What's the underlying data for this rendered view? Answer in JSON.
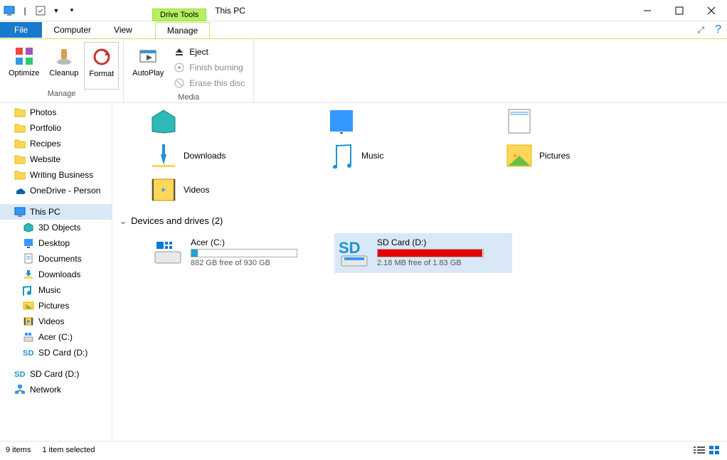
{
  "title": "This PC",
  "titlebar": {
    "drive_tools": "Drive Tools"
  },
  "tabs": {
    "file": "File",
    "computer": "Computer",
    "view": "View",
    "manage": "Manage"
  },
  "ribbon": {
    "manage_group": {
      "label": "Manage",
      "optimize": "Optimize",
      "cleanup": "Cleanup",
      "format": "Format"
    },
    "media_group": {
      "label": "Media",
      "autoplay": "AutoPlay",
      "eject": "Eject",
      "finish_burning": "Finish burning",
      "erase_disc": "Erase this disc"
    }
  },
  "sidebar": {
    "items": [
      {
        "label": "Photos",
        "icon": "folder"
      },
      {
        "label": "Portfolio",
        "icon": "folder"
      },
      {
        "label": "Recipes",
        "icon": "folder"
      },
      {
        "label": "Website",
        "icon": "folder"
      },
      {
        "label": "Writing Business",
        "icon": "folder"
      },
      {
        "label": "OneDrive - Person",
        "icon": "onedrive"
      },
      {
        "label": "This PC",
        "icon": "pc",
        "selected": true
      },
      {
        "label": "3D Objects",
        "icon": "3d",
        "level": 2
      },
      {
        "label": "Desktop",
        "icon": "desktop",
        "level": 2
      },
      {
        "label": "Documents",
        "icon": "documents",
        "level": 2
      },
      {
        "label": "Downloads",
        "icon": "downloads",
        "level": 2
      },
      {
        "label": "Music",
        "icon": "music",
        "level": 2
      },
      {
        "label": "Pictures",
        "icon": "pictures",
        "level": 2
      },
      {
        "label": "Videos",
        "icon": "videos",
        "level": 2
      },
      {
        "label": "Acer (C:)",
        "icon": "disk",
        "level": 2
      },
      {
        "label": "SD Card (D:)",
        "icon": "sd",
        "level": 2
      },
      {
        "label": "SD Card (D:)",
        "icon": "sd"
      },
      {
        "label": "Network",
        "icon": "network"
      }
    ]
  },
  "folders_row1": [
    {
      "label": "",
      "icon": "3d",
      "sync": "check"
    },
    {
      "label": "",
      "icon": "desktop",
      "sync": "check"
    },
    {
      "label": "",
      "icon": "documents"
    }
  ],
  "folders_row2": [
    {
      "label": "Downloads",
      "icon": "downloads"
    },
    {
      "label": "Music",
      "icon": "music",
      "sync": "cloud"
    },
    {
      "label": "Pictures",
      "icon": "pictures"
    }
  ],
  "folders_row3": [
    {
      "label": "Videos",
      "icon": "videos"
    }
  ],
  "devices_header": "Devices and drives (2)",
  "drives": [
    {
      "name": "Acer (C:)",
      "free": "882 GB free of 930 GB",
      "fill_pct": 6,
      "color": "#26a0da",
      "icon": "windisk"
    },
    {
      "name": "SD Card (D:)",
      "free": "2.18 MB free of 1.83 GB",
      "fill_pct": 99,
      "color": "#e60000",
      "icon": "sd",
      "selected": true
    }
  ],
  "status": {
    "items": "9 items",
    "selected": "1 item selected"
  }
}
